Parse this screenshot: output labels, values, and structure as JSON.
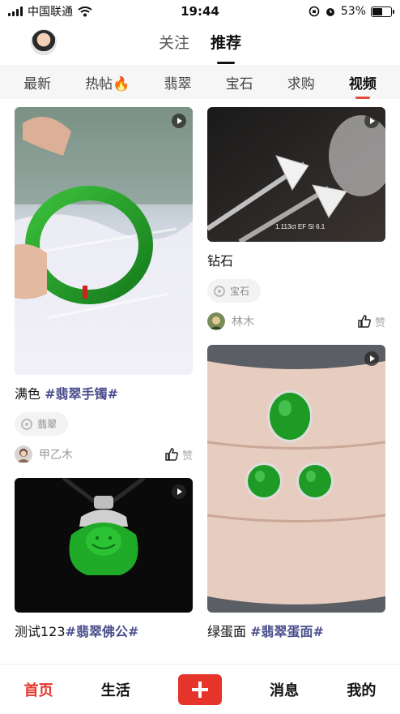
{
  "status_bar": {
    "carrier": "中国联通",
    "time": "19:44",
    "battery": "53%",
    "battery_level": 0.53
  },
  "header": {
    "tabs": [
      {
        "label": "关注",
        "active": false
      },
      {
        "label": "推荐",
        "active": true
      }
    ]
  },
  "categories": [
    {
      "label": "最新"
    },
    {
      "label": "热帖🔥"
    },
    {
      "label": "翡翠"
    },
    {
      "label": "宝石"
    },
    {
      "label": "求购"
    },
    {
      "label": "视频",
      "active": true
    }
  ],
  "cards": {
    "c1": {
      "title": "满色 ",
      "tag": "#翡翠手镯#",
      "chip": "翡翠",
      "author": "甲乙木",
      "like": "赞"
    },
    "c2": {
      "title": "测试123",
      "tag": "#翡翠佛公#"
    },
    "c3": {
      "title": "钻石",
      "tag": "",
      "chip": "宝石",
      "author": "林木",
      "like": "赞",
      "image_text": "1.113ct EF SI 6.1"
    },
    "c4": {
      "title": "绿蛋面 ",
      "tag": "#翡翠蛋面#"
    }
  },
  "bottom_nav": [
    {
      "label": "首页",
      "active": true
    },
    {
      "label": "生活"
    },
    {
      "label": "add"
    },
    {
      "label": "消息"
    },
    {
      "label": "我的"
    }
  ],
  "colors": {
    "accent": "#e5342a",
    "tag": "#4a4f8c",
    "jade": "#1f9a2a"
  }
}
